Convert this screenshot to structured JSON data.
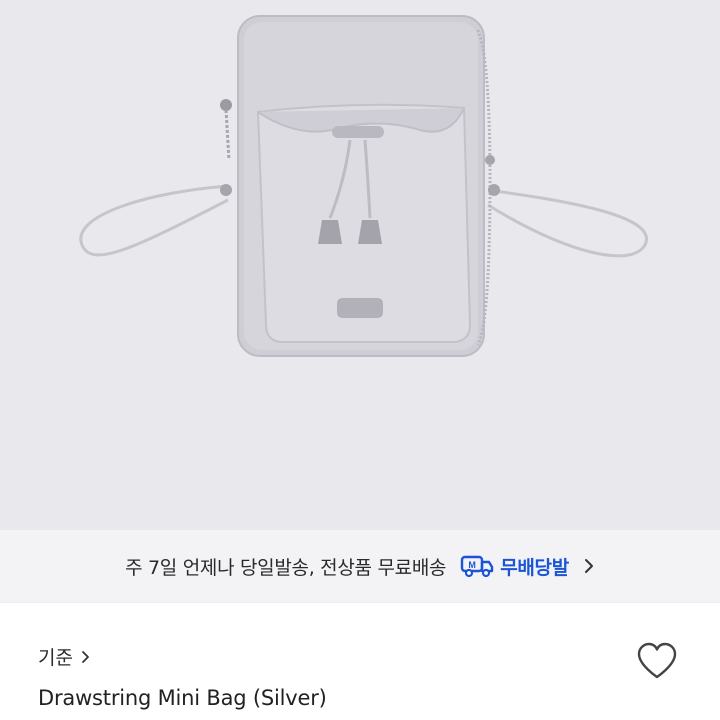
{
  "product_image": {
    "alt_icon": "drawstring-mini-bag-photo",
    "background": "#e9e8ed"
  },
  "shipping_banner": {
    "text": "주 7일 언제나 당일발송, 전상품 무료배송",
    "badge_icon": "truck-m-icon",
    "badge_label": "무배당발",
    "badge_color": "#1b55d6",
    "chevron_icon": "chevron-right-icon"
  },
  "product": {
    "brand": "기준",
    "brand_chevron_icon": "chevron-right-icon",
    "title": "Drawstring Mini Bag (Silver)",
    "like_icon": "heart-outline-icon"
  }
}
